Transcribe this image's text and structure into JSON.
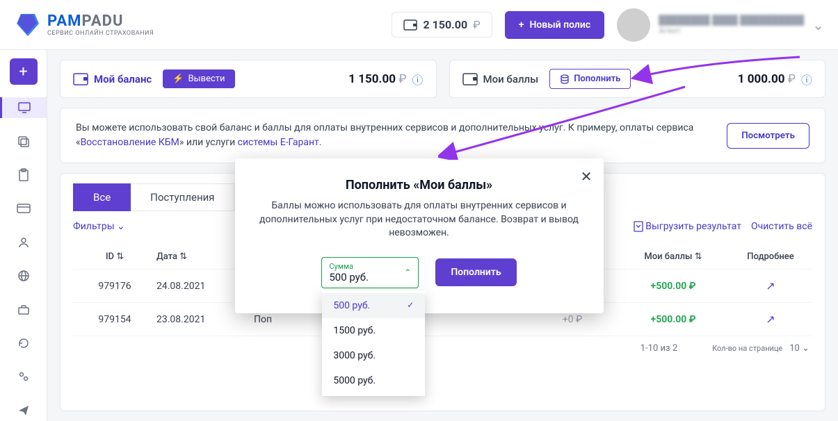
{
  "header": {
    "logo_title_a": "PAM",
    "logo_title_b": "PADU",
    "logo_sub": "СЕРВИС ОНЛАЙН СТРАХОВАНИЯ",
    "wallet_value": "2 150.00",
    "wallet_currency": "₽",
    "new_policy": "Новый полис",
    "user_name": "████████ ████ ██████████",
    "user_role": "Агент",
    "user_email": "████████████████"
  },
  "balance_card": {
    "title": "Мой баланс",
    "withdraw": "Вывести",
    "value": "1 150.00",
    "currency": "₽"
  },
  "points_card": {
    "title": "Мои баллы",
    "topup": "Пополнить",
    "value": "1 000.00",
    "currency": "₽"
  },
  "info": {
    "text_a": "Вы можете использовать свой баланс и баллы для оплаты внутренних сервисов и дополнительных услуг. К примеру, оплаты сервиса «",
    "link_a": "Восстановление КБМ",
    "text_b": "» или услуги ",
    "link_b": "системы Е-Гарант",
    "text_c": ".",
    "view": "Посмотреть"
  },
  "tabs": {
    "all": "Все",
    "income": "Поступления"
  },
  "filters": {
    "label": "Фильтры",
    "export": "Выгрузить результат",
    "clear": "Очистить всё"
  },
  "table": {
    "headers": {
      "id": "ID",
      "date": "Дата",
      "desc": "",
      "points": "Мои баллы",
      "more": "Подробнее"
    },
    "rows": [
      {
        "id": "979176",
        "date": "24.08.2021",
        "desc": "",
        "balance_change": "",
        "points_change": "+500.00 ₽"
      },
      {
        "id": "979154",
        "date": "23.08.2021",
        "desc": "Поп",
        "balance_change": "+0 ₽",
        "points_change": "+500.00 ₽"
      }
    ],
    "footer_range": "1-10 из 2",
    "footer_perpage_label": "Кол-во на странице",
    "footer_perpage_value": "10"
  },
  "modal": {
    "title": "Пополнить «Мои баллы»",
    "desc": "Баллы можно использовать для оплаты внутренних сервисов и дополнительных услуг при недостаточном балансе. Возврат и вывод невозможен.",
    "amount_label": "Сумма",
    "amount_value": "500 руб.",
    "submit": "Пополнить",
    "options": [
      "500 руб.",
      "1500 руб.",
      "3000 руб.",
      "5000 руб."
    ]
  }
}
